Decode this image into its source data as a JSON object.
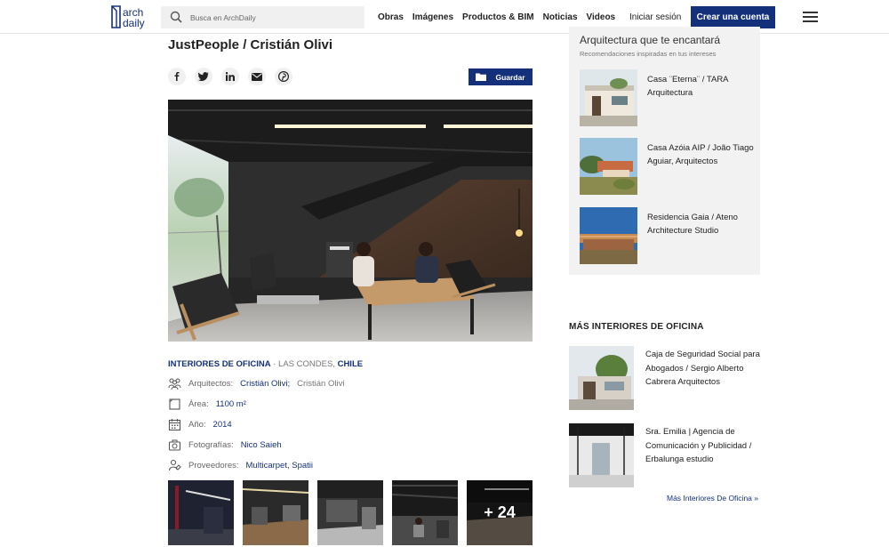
{
  "colors": {
    "brand": "#14307a",
    "link": "#14307a",
    "sidebar_bg": "#f2f2f2"
  },
  "header": {
    "logo_line1": "arch",
    "logo_line2": "daily",
    "search_placeholder": "Busca en ArchDaily",
    "nav": [
      "Obras",
      "Imágenes",
      "Productos & BIM",
      "Noticias",
      "Videos"
    ],
    "login": "Iniciar sesión",
    "signup": "Crear una cuenta"
  },
  "article": {
    "title": "JustPeople / Cristián Olivi",
    "social_icons": [
      "facebook-icon",
      "twitter-icon",
      "linkedin-icon",
      "email-icon",
      "pinterest-icon"
    ],
    "save_label": "Guardar",
    "category": "INTERIORES DE OFICINA",
    "separator": " · ",
    "location_city": "LAS CONDES, ",
    "location_country": "CHILE",
    "specs": {
      "architects": {
        "label": "Arquitectos:",
        "value": "Cristián Olivi;",
        "extra": "Cristián Olivi"
      },
      "area": {
        "label": "Área:",
        "value": "1100 m²"
      },
      "year": {
        "label": "Año:",
        "value": "2014"
      },
      "photos": {
        "label": "Fotografías:",
        "value": "Nico Saieh"
      },
      "suppliers": {
        "label": "Proveedores:",
        "value": "Multicarpet, Spatii"
      }
    },
    "more_photos": "+ 24"
  },
  "sidebar": {
    "heading": "Arquitectura que te encantará",
    "subheading": "Recomendaciones inspiradas en tus intereses",
    "items": [
      {
        "title": "Casa ¨Eterna¨ / TARA Arquitectura"
      },
      {
        "title": "Casa Azóia AIP / João Tiago Aguiar, Arquitectos"
      },
      {
        "title": "Residencia Gaia / Ateno Architecture Studio"
      }
    ]
  },
  "more_section": {
    "heading": "MÁS INTERIORES DE OFICINA",
    "items": [
      {
        "title": "Caja de Seguridad Social para Abogados / Sergio Alberto Cabrera Arquitectos"
      },
      {
        "title": "Sra. Emilia | Agencia de Comunicación y Publicidad / Erbalunga estudio"
      }
    ],
    "more_link": "Más Interiores De Oficina »"
  }
}
